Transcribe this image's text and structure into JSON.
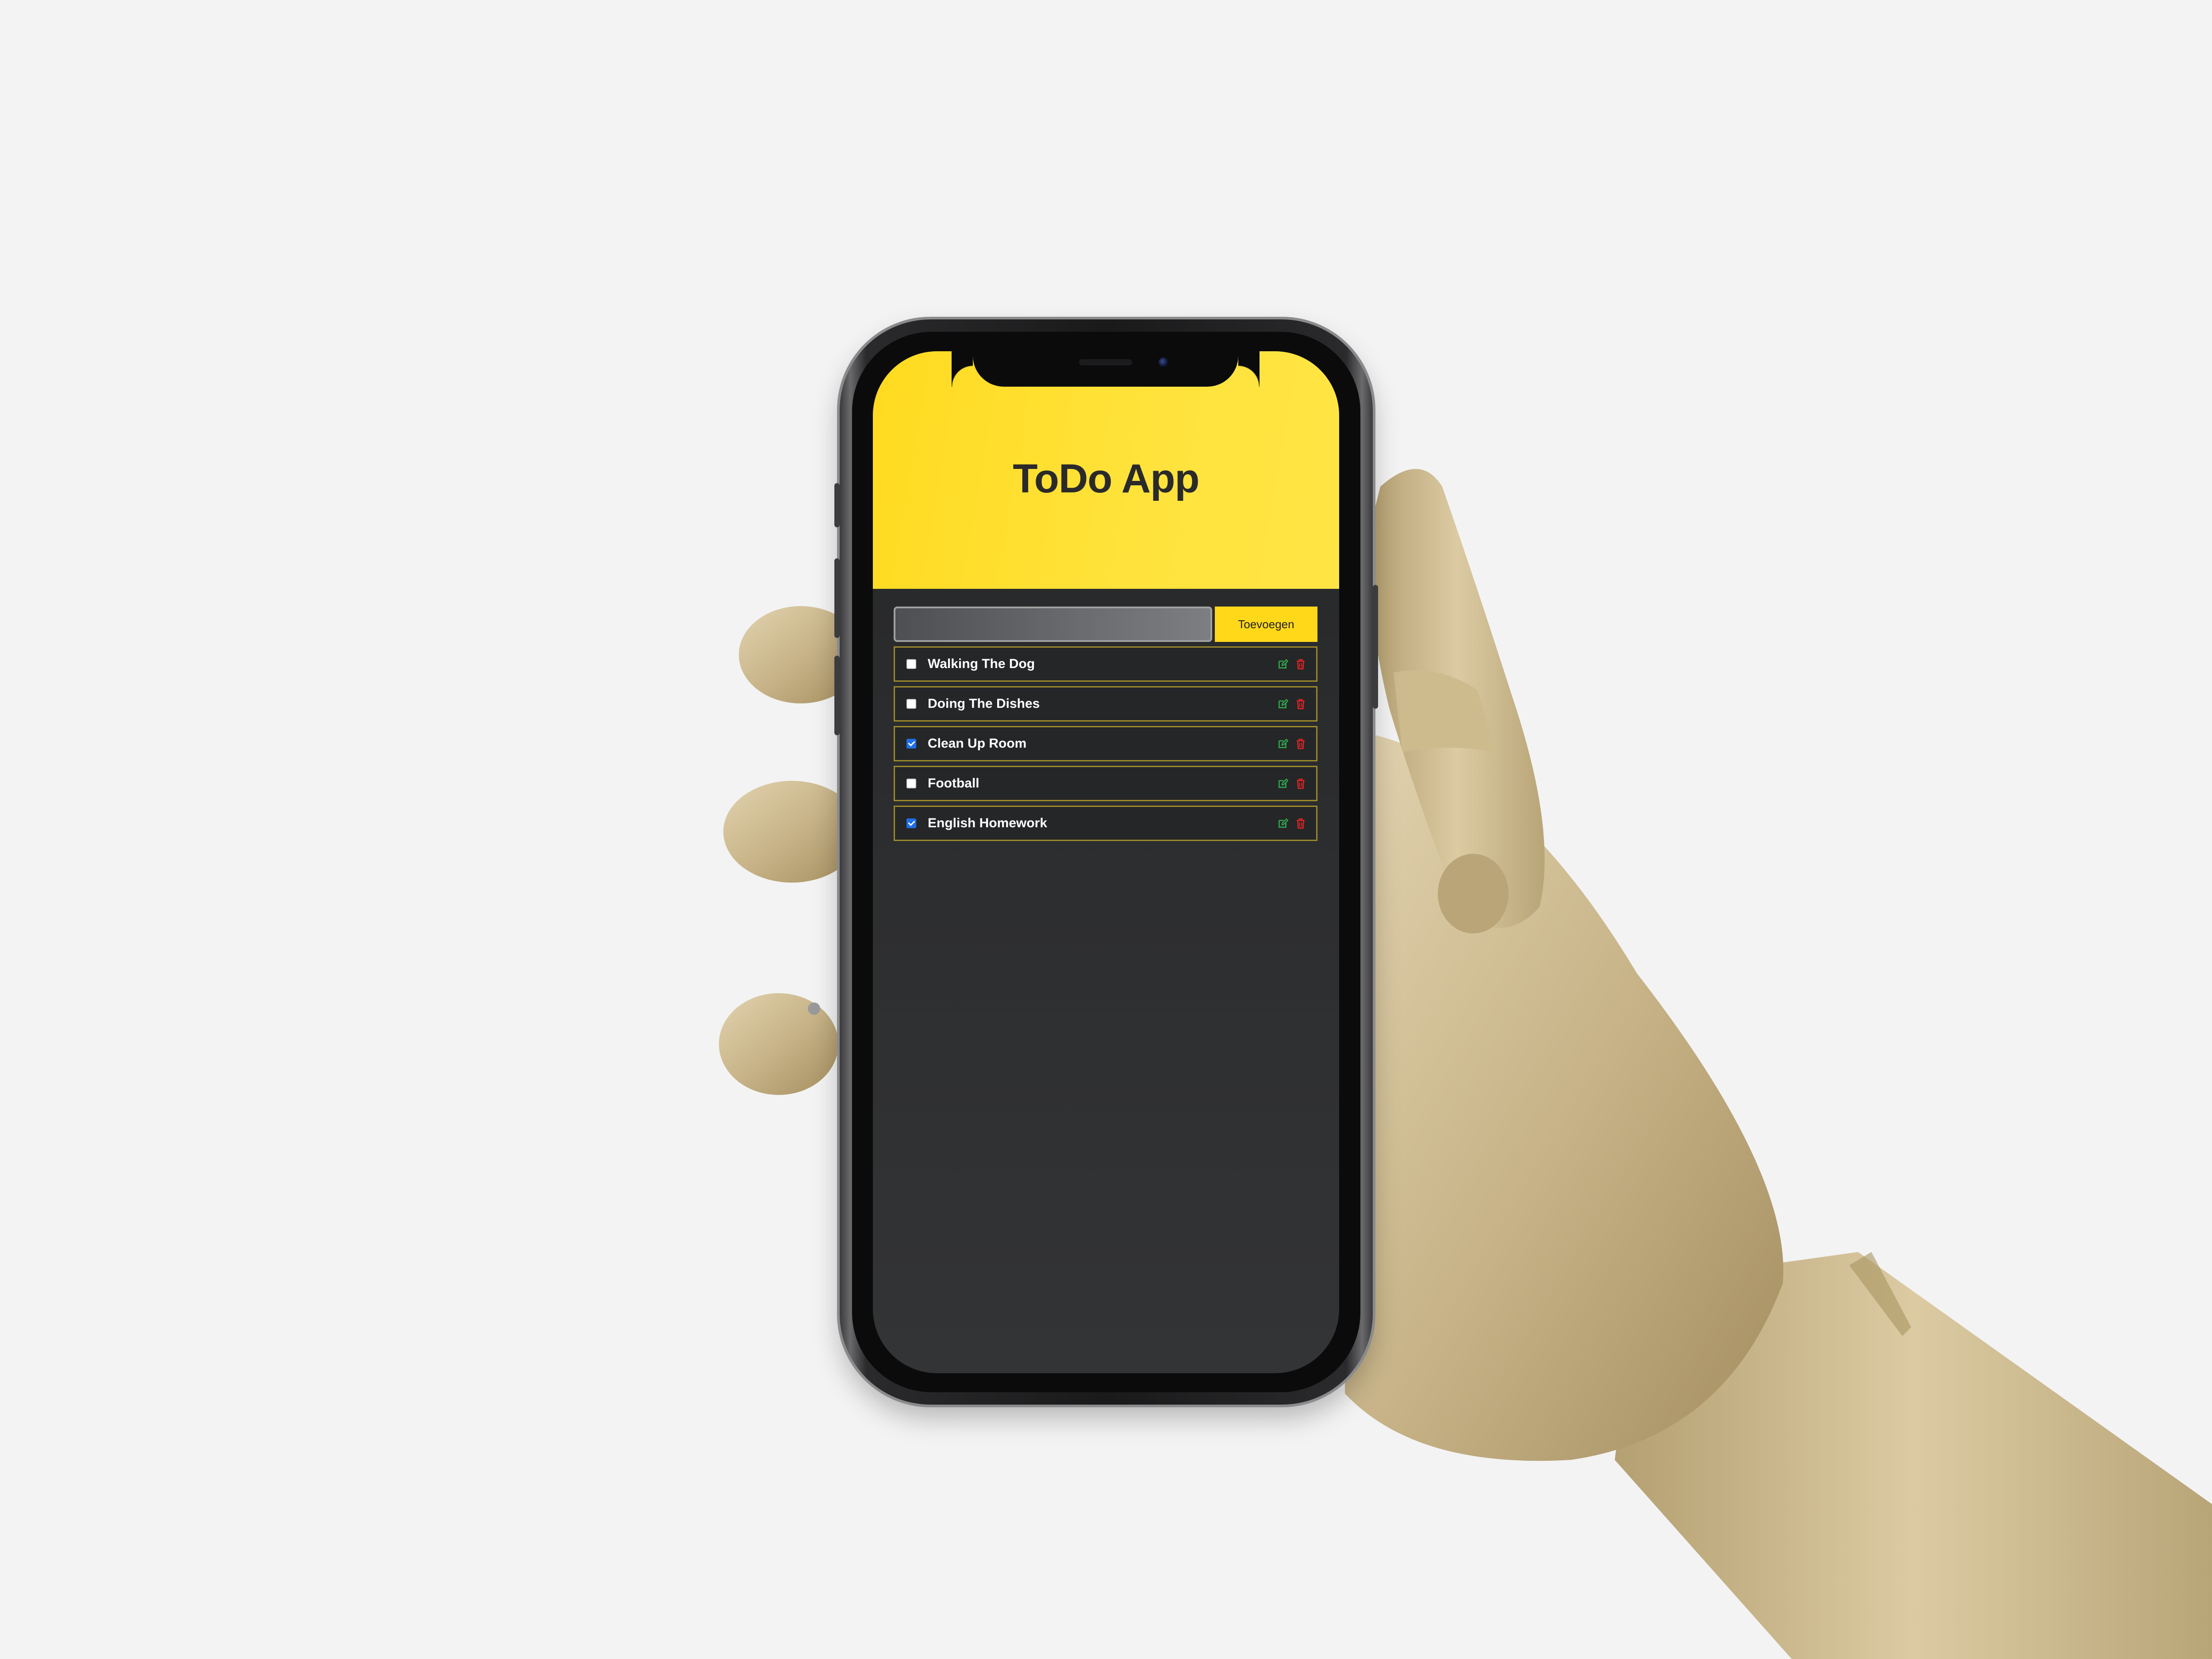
{
  "app": {
    "title": "ToDo App"
  },
  "add_form": {
    "input_value": "",
    "input_placeholder": "",
    "button_label": "Toevoegen"
  },
  "todos": [
    {
      "label": "Walking The Dog",
      "checked": false
    },
    {
      "label": "Doing The Dishes",
      "checked": false
    },
    {
      "label": "Clean Up Room",
      "checked": true
    },
    {
      "label": "Football",
      "checked": false
    },
    {
      "label": "English Homework",
      "checked": true
    }
  ],
  "icons": {
    "edit": "edit-icon",
    "delete": "trash-icon"
  },
  "colors": {
    "header_yellow": "#ffdc24",
    "button_yellow": "#ffd81a",
    "background_dark": "#2c2d2f",
    "item_border": "#9c8a2c",
    "edit_green": "#2fa24a",
    "delete_red": "#d32424",
    "checkbox_blue": "#1f6fe5"
  }
}
